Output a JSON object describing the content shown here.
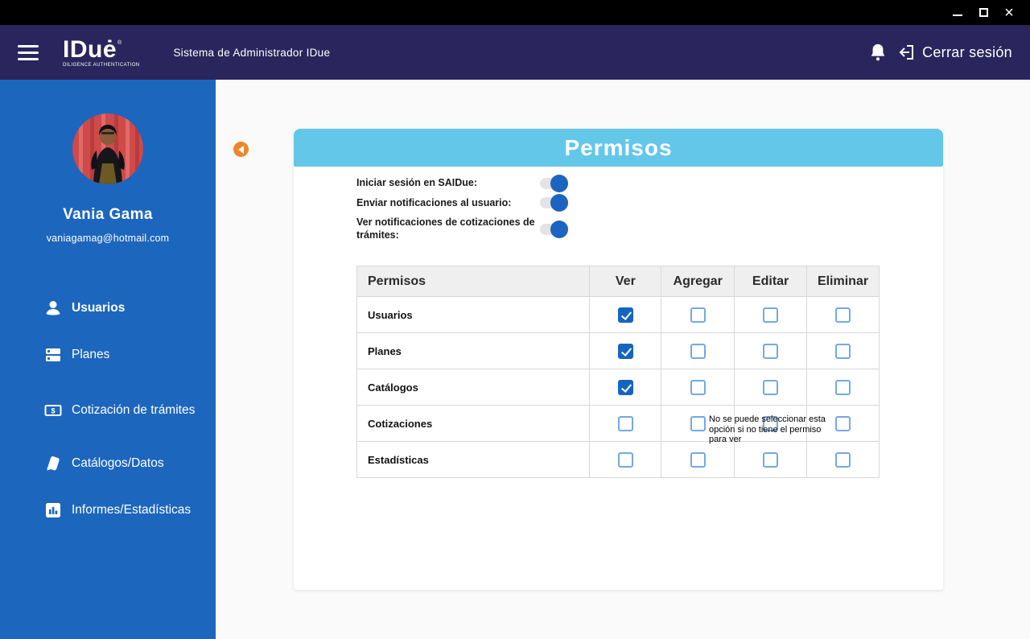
{
  "window": {
    "minimize_icon": "minimize",
    "maximize_icon": "maximize",
    "close_icon": "✕"
  },
  "header": {
    "logo_text": "IDuė",
    "logo_registered": "®",
    "logo_tagline": "DILIGENCE AUTHENTICATION",
    "app_title": "Sistema de Administrador IDue",
    "logout_label": "Cerrar sesión"
  },
  "sidebar": {
    "user": {
      "name": "Vania Gama",
      "email": "vaniagamag@hotmail.com"
    },
    "items": [
      {
        "label": "Usuarios",
        "icon": "user-icon",
        "active": true
      },
      {
        "label": "Planes",
        "icon": "plans-icon",
        "active": false
      },
      {
        "label": "Cotización de trámites",
        "icon": "quote-icon",
        "active": false
      },
      {
        "label": "Catálogos/Datos",
        "icon": "catalog-icon",
        "active": false
      },
      {
        "label": "Informes/Estadísticas",
        "icon": "bar-chart-icon",
        "active": false
      }
    ]
  },
  "main": {
    "panel_title": "Permisos",
    "toggles": [
      {
        "label": "Iniciar sesión en SAIDue:",
        "on": true
      },
      {
        "label": "Enviar notificaciones al usuario:",
        "on": true
      },
      {
        "label": "Ver notificaciones de cotizaciones de trámites:",
        "on": true
      }
    ],
    "table": {
      "columns": [
        "Permisos",
        "Ver",
        "Agregar",
        "Editar",
        "Eliminar"
      ],
      "rows": [
        {
          "label": "Usuarios",
          "permissions": {
            "ver": true,
            "agregar": false,
            "editar": false,
            "eliminar": false
          }
        },
        {
          "label": "Planes",
          "permissions": {
            "ver": true,
            "agregar": false,
            "editar": false,
            "eliminar": false
          }
        },
        {
          "label": "Catálogos",
          "permissions": {
            "ver": true,
            "agregar": false,
            "editar": false,
            "eliminar": false
          }
        },
        {
          "label": "Cotizaciones",
          "permissions": {
            "ver": false,
            "agregar": false,
            "editar": false,
            "eliminar": false
          }
        },
        {
          "label": "Estadísticas",
          "permissions": {
            "ver": false,
            "agregar": false,
            "editar": false,
            "eliminar": false
          }
        }
      ],
      "tooltip": "No se puede seleccionar esta opción si no tiene el permiso para ver"
    }
  },
  "colors": {
    "titlebar": "#000000",
    "header": "#2a255c",
    "sidebar": "#1d66bd",
    "panel_header": "#63c7ea",
    "back_button": "#f08629",
    "checkbox_checked": "#1565c0",
    "checkbox_border": "#74a9e0",
    "toggle_on": "#1d64c1"
  }
}
